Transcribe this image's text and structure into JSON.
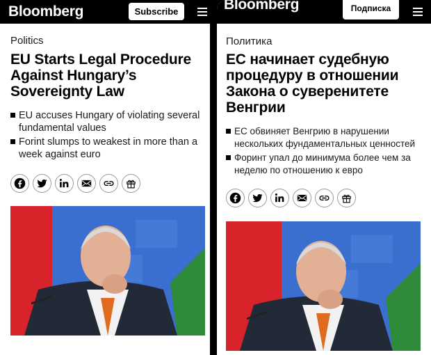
{
  "left_panel": {
    "brand": "Bloomberg",
    "subscribe_label": "Subscribe",
    "category": "Politics",
    "headline": "EU Starts Legal Procedure Against Hungary’s Sovereignty Law",
    "bullets": [
      "EU accuses Hungary of violating several fundamental values",
      "Forint slumps to weakest in more than a week against euro"
    ]
  },
  "right_panel": {
    "brand": "Bloomberg",
    "subscribe_label": "Подписка",
    "category": "Политика",
    "headline": "ЕС начинает судебную процедуру в отношении Закона о суверенитете Венгрии",
    "bullets": [
      "ЕС обвиняет Венгрию в нарушении нескольких фундаментальных ценностей",
      "Форинт упал до минимума более чем за неделю по отношению к евро"
    ]
  },
  "share_icons": [
    "facebook-icon",
    "twitter-icon",
    "linkedin-icon",
    "email-icon",
    "link-icon",
    "gift-icon"
  ],
  "colors": {
    "topbar": "#000000",
    "background": "#ffffff",
    "flag_red": "#d8232a",
    "flag_green": "#2e8b3a",
    "backdrop_blue": "#3a6fd0"
  }
}
